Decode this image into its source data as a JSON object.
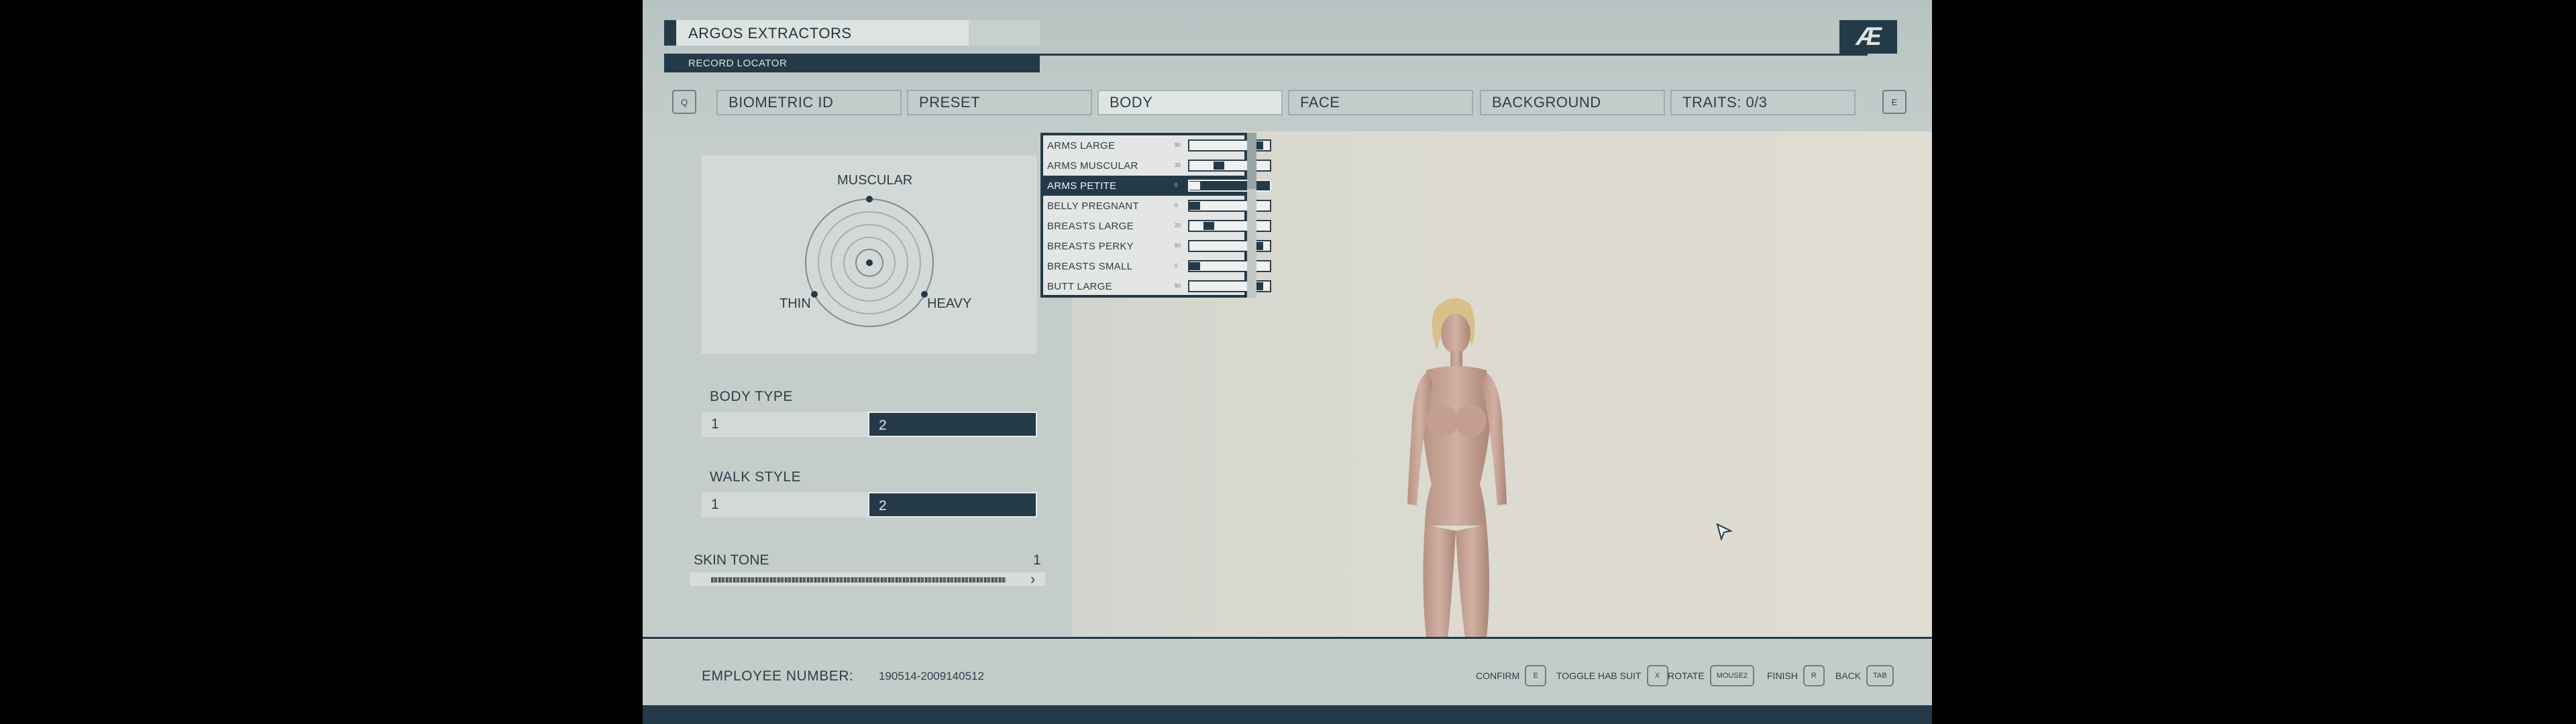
{
  "header": {
    "company": "ARGOS EXTRACTORS",
    "record_locator": "RECORD LOCATOR",
    "logo_text": "Æ"
  },
  "tabs": {
    "prev_key": "Q",
    "next_key": "E",
    "items": [
      {
        "label": "BIOMETRIC ID",
        "active": false
      },
      {
        "label": "PRESET",
        "active": false
      },
      {
        "label": "BODY",
        "active": true
      },
      {
        "label": "FACE",
        "active": false
      },
      {
        "label": "BACKGROUND",
        "active": false
      },
      {
        "label": "TRAITS: 0/3",
        "active": false
      }
    ]
  },
  "body_shape": {
    "muscular": "MUSCULAR",
    "thin": "THIN",
    "heavy": "HEAVY"
  },
  "body_type": {
    "label": "BODY TYPE",
    "options": [
      "1",
      "2"
    ],
    "selected": "2"
  },
  "walk_style": {
    "label": "WALK STYLE",
    "options": [
      "1",
      "2"
    ],
    "selected": "2"
  },
  "skin_tone": {
    "label": "SKIN TONE",
    "value": "1",
    "arrow": "›"
  },
  "morphs": [
    {
      "name": "ARMS LARGE",
      "value": "90",
      "level": 0.9,
      "selected": false
    },
    {
      "name": "ARMS MUSCULAR",
      "value": "35",
      "level": 0.35,
      "selected": false
    },
    {
      "name": "ARMS PETITE",
      "value": "0",
      "level": 0.0,
      "selected": true
    },
    {
      "name": "BELLY PREGNANT",
      "value": "0",
      "level": 0.0,
      "selected": false
    },
    {
      "name": "BREASTS LARGE",
      "value": "20",
      "level": 0.2,
      "selected": false
    },
    {
      "name": "BREASTS PERKY",
      "value": "90",
      "level": 0.9,
      "selected": false
    },
    {
      "name": "BREASTS SMALL",
      "value": "0",
      "level": 0.0,
      "selected": false
    },
    {
      "name": "BUTT LARGE",
      "value": "90",
      "level": 0.9,
      "selected": false
    }
  ],
  "footer": {
    "employee_label": "EMPLOYEE NUMBER:",
    "employee_number": "190514-2009140512",
    "hints": [
      {
        "label": "CONFIRM",
        "key": "E"
      },
      {
        "label": "TOGGLE HAB SUIT",
        "key": "X"
      },
      {
        "label": "ROTATE",
        "key": "MOUSE2"
      },
      {
        "label": "FINISH",
        "key": "R"
      },
      {
        "label": "BACK",
        "key": "TAB"
      }
    ]
  },
  "colors": {
    "accent_dark": "#243a48",
    "panel": "#c5cdca",
    "background": "#d6d9d3",
    "skin": "#c9a79a",
    "hair": "#d8c08a"
  }
}
